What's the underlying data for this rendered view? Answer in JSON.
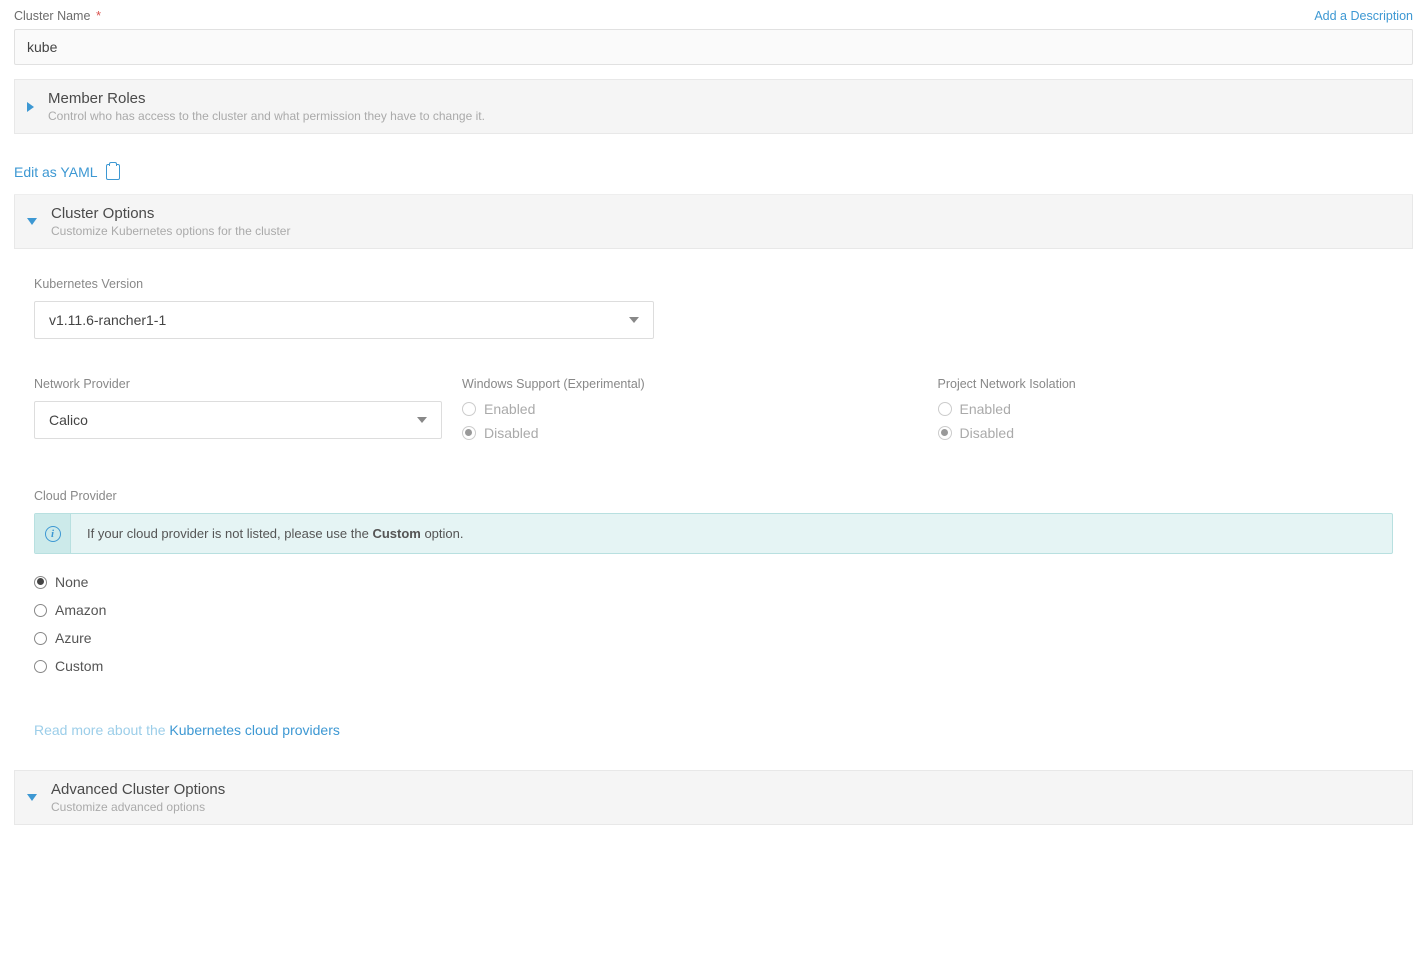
{
  "clusterName": {
    "label": "Cluster Name",
    "value": "kube"
  },
  "addDescription": "Add a Description",
  "memberRoles": {
    "title": "Member Roles",
    "sub": "Control who has access to the cluster and what permission they have to change it."
  },
  "editYaml": "Edit as YAML",
  "clusterOptions": {
    "title": "Cluster Options",
    "sub": "Customize Kubernetes options for the cluster"
  },
  "k8sVersion": {
    "label": "Kubernetes Version",
    "value": "v1.11.6-rancher1-1"
  },
  "networkProvider": {
    "label": "Network Provider",
    "value": "Calico"
  },
  "windowsSupport": {
    "label": "Windows Support (Experimental)",
    "enabled": "Enabled",
    "disabled": "Disabled",
    "selected": "Disabled"
  },
  "projectIsolation": {
    "label": "Project Network Isolation",
    "enabled": "Enabled",
    "disabled": "Disabled",
    "selected": "Disabled"
  },
  "cloudProvider": {
    "label": "Cloud Provider",
    "infoPrefix": "If your cloud provider is not listed, please use the ",
    "infoBold": "Custom",
    "infoSuffix": " option.",
    "options": [
      "None",
      "Amazon",
      "Azure",
      "Custom"
    ],
    "selected": "None",
    "readMorePrefix": "Read more about the ",
    "readMoreLink": "Kubernetes cloud providers"
  },
  "advanced": {
    "title": "Advanced Cluster Options",
    "sub": "Customize advanced options"
  }
}
